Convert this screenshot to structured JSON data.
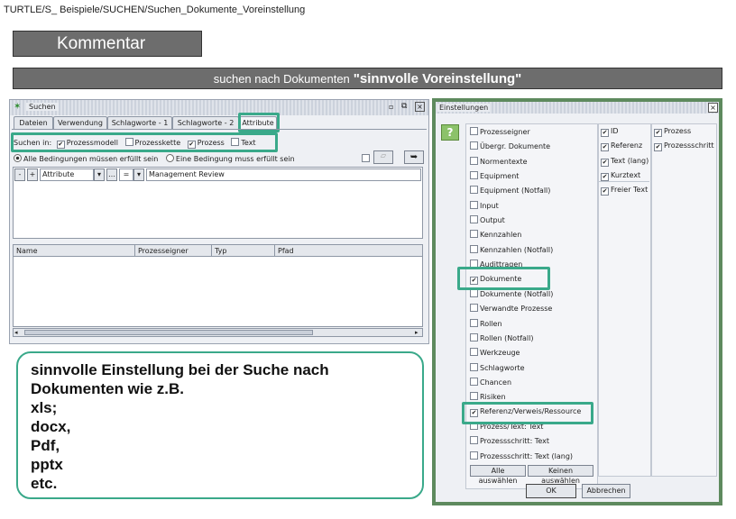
{
  "breadcrumb": "TURTLE/S_ Beispiele/SUCHEN/Suchen_Dokumente_Voreinstellung",
  "comment_label": "Kommentar",
  "banner": {
    "prefix": "suchen nach Dokumenten",
    "emph": "\"sinnvolle Voreinstellung\""
  },
  "search_window": {
    "title": "Suchen",
    "tabs": [
      "Dateien",
      "Verwendung",
      "Schlagworte - 1",
      "Schlagworte - 2",
      "Attribute"
    ],
    "search_in_label": "Suchen in:",
    "search_in": [
      {
        "label": "Prozessmodell",
        "checked": true
      },
      {
        "label": "Prozesskette",
        "checked": false
      },
      {
        "label": "Prozess",
        "checked": true
      },
      {
        "label": "Text",
        "checked": false
      }
    ],
    "radio_all": "Alle Bedingungen müssen erfüllt sein",
    "radio_any": "Eine Bedingung muss erfüllt sein",
    "criteria": {
      "field": "Attribute",
      "op": "=",
      "value": "Management Review"
    },
    "result_columns": [
      "Name",
      "Prozesseigner",
      "Typ",
      "Pfad"
    ]
  },
  "settings_window": {
    "title": "Einstellungen",
    "help": "?",
    "col1": [
      {
        "label": "Prozesseigner",
        "checked": false
      },
      {
        "label": "Übergr. Dokumente",
        "checked": false
      },
      {
        "label": "Normentexte",
        "checked": false
      },
      {
        "label": "Equipment",
        "checked": false
      },
      {
        "label": "Equipment (Notfall)",
        "checked": false
      },
      {
        "label": "Input",
        "checked": false
      },
      {
        "label": "Output",
        "checked": false
      },
      {
        "label": "Kennzahlen",
        "checked": false
      },
      {
        "label": "Kennzahlen (Notfall)",
        "checked": false
      },
      {
        "label": "Audittragen",
        "checked": false
      },
      {
        "label": "Dokumente",
        "checked": true
      },
      {
        "label": "Dokumente (Notfall)",
        "checked": false
      },
      {
        "label": "Verwandte Prozesse",
        "checked": false
      },
      {
        "label": "Rollen",
        "checked": false
      },
      {
        "label": "Rollen (Notfall)",
        "checked": false
      },
      {
        "label": "Werkzeuge",
        "checked": false
      },
      {
        "label": "Schlagworte",
        "checked": false
      },
      {
        "label": "Chancen",
        "checked": false
      },
      {
        "label": "Risiken",
        "checked": false
      },
      {
        "label": "Referenz/Verweis/Ressource",
        "checked": true
      },
      {
        "label": "Prozess/Text: Text",
        "checked": false
      },
      {
        "label": "Prozessschritt: Text",
        "checked": false
      },
      {
        "label": "Prozessschritt: Text (lang)",
        "checked": false
      }
    ],
    "col2": [
      {
        "label": "ID",
        "checked": true
      },
      {
        "label": "Referenz",
        "checked": true
      },
      {
        "label": "Text (lang)",
        "checked": true
      },
      {
        "label": "Kurztext",
        "checked": true
      }
    ],
    "col2b": [
      {
        "label": "Freier Text",
        "checked": true
      }
    ],
    "col3": [
      {
        "label": "Prozess",
        "checked": true
      },
      {
        "label": "Prozessschritt",
        "checked": true
      }
    ],
    "select_all": "Alle auswählen",
    "select_none": "Keinen auswählen",
    "ok": "OK",
    "cancel": "Abbrechen"
  },
  "note": {
    "lines": [
      "sinnvolle Einstellung bei der Suche nach",
      "Dokumenten wie z.B.",
      "xls;",
      "docx,",
      "Pdf,",
      "pptx",
      "etc."
    ]
  }
}
